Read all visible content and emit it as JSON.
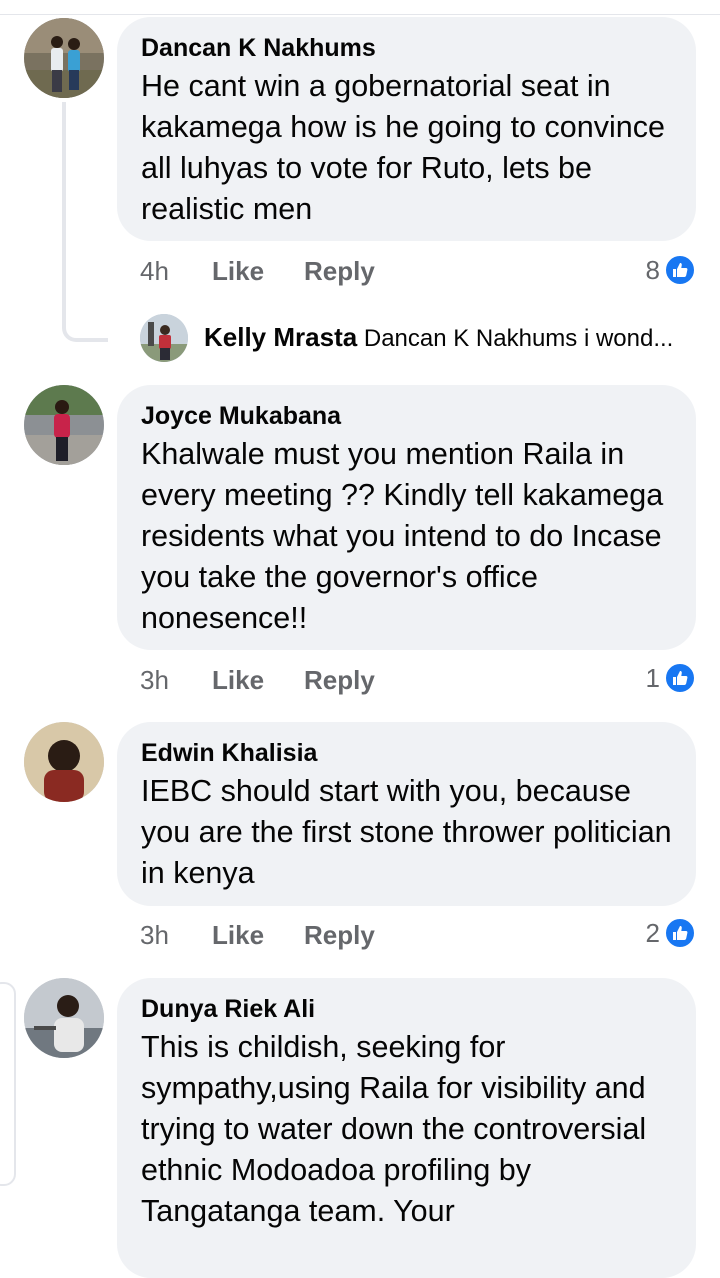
{
  "comments": [
    {
      "author": "Dancan K Nakhums",
      "text": "He cant win a gobernatorial seat in kakamega how is he going to convince all luhyas to vote for Ruto, lets be realistic men",
      "time": "4h",
      "like": "Like",
      "reply": "Reply",
      "reactions": "8"
    },
    {
      "author": "Joyce Mukabana",
      "text": "Khalwale must you mention Raila in every meeting ?? Kindly tell kakamega residents what you intend to do Incase you take the governor's office nonesence!!",
      "time": "3h",
      "like": "Like",
      "reply": "Reply",
      "reactions": "1"
    },
    {
      "author": "Edwin Khalisia",
      "text": "IEBC should start with you, because you are the first stone thrower politician in kenya",
      "time": "3h",
      "like": "Like",
      "reply": "Reply",
      "reactions": "2"
    },
    {
      "author": "Dunya Riek Ali",
      "text": "This is childish, seeking for sympathy,using Raila for visibility and trying to water down the controversial ethnic Modoadoa profiling by Tangatanga team. Your"
    }
  ],
  "reply_preview": {
    "author": "Kelly Mrasta",
    "text": "Dancan K Nakhums i wond..."
  },
  "colors": {
    "bubble": "#f0f2f5",
    "like_badge": "#1877f2",
    "secondary_text": "#65676b"
  },
  "icons": [
    "like-badge-icon"
  ]
}
